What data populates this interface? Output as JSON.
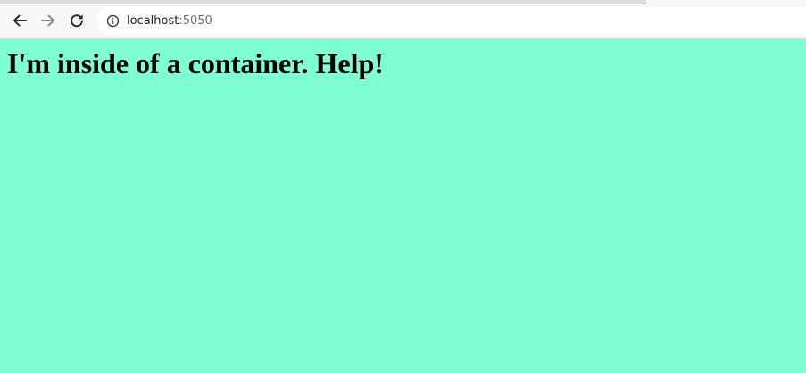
{
  "browser": {
    "url_host": "localhost",
    "url_port": ":5050",
    "back_icon": "arrow-left",
    "forward_icon": "arrow-right",
    "reload_icon": "reload",
    "site_info_icon": "info-circle"
  },
  "page": {
    "background_color": "#7fffd4",
    "heading": "I'm inside of a container. Help!"
  }
}
